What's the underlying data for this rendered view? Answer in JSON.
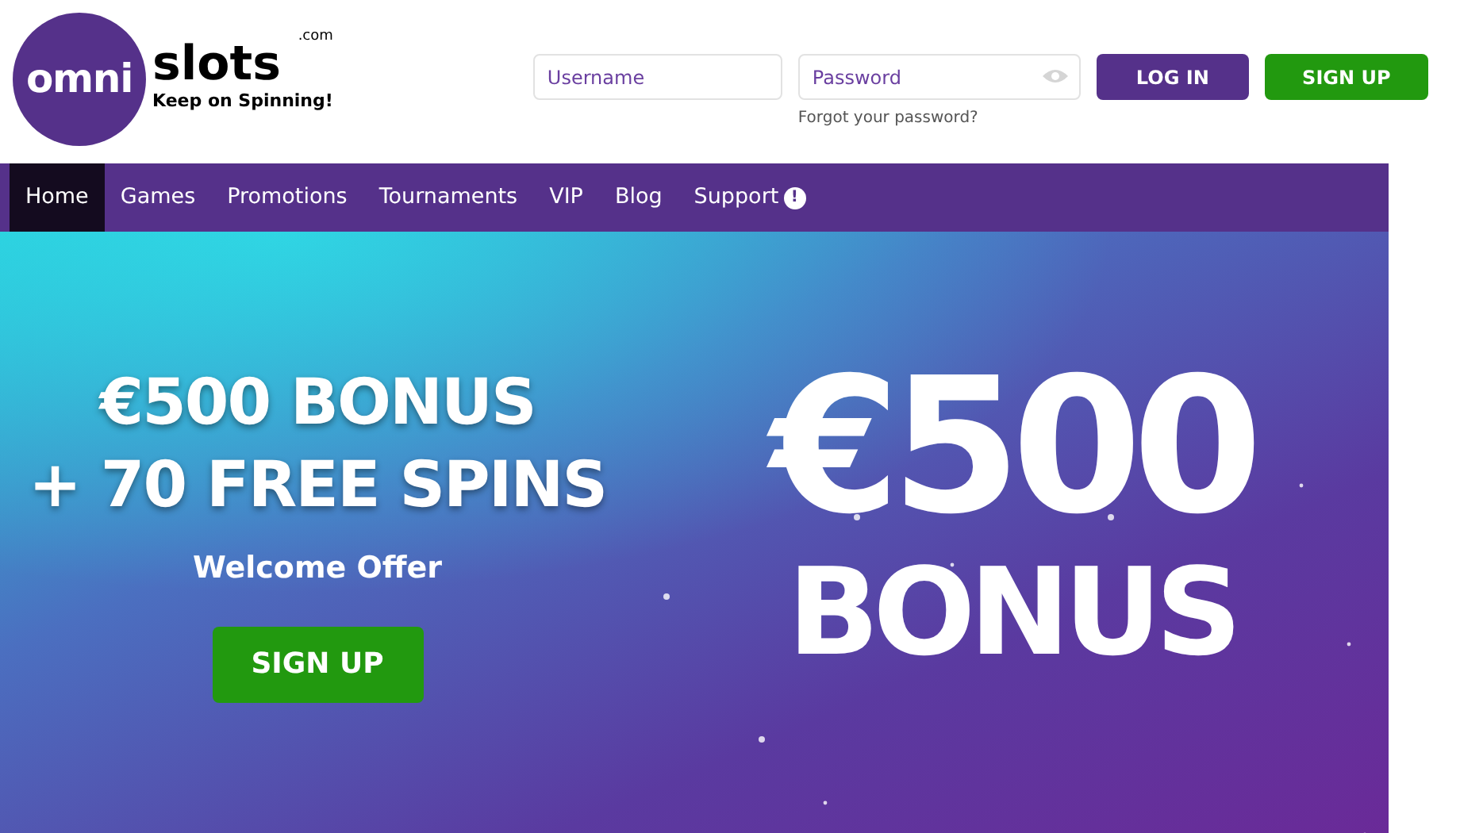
{
  "logo": {
    "circle_text": "omni",
    "wordmark": "slots",
    "domain": ".com",
    "tagline": "Keep on Spinning!"
  },
  "login": {
    "username": {
      "placeholder": "Username"
    },
    "password": {
      "placeholder": "Password"
    },
    "forgot": "Forgot your password?",
    "login_button": "LOG IN",
    "signup_button": "SIGN UP"
  },
  "nav": [
    {
      "label": "Home",
      "selected": true
    },
    {
      "label": "Games",
      "selected": false
    },
    {
      "label": "Promotions",
      "selected": false
    },
    {
      "label": "Tournaments",
      "selected": false
    },
    {
      "label": "VIP",
      "selected": false
    },
    {
      "label": "Blog",
      "selected": false
    },
    {
      "label": "Support",
      "selected": false,
      "badge": "!"
    }
  ],
  "hero": {
    "headline": [
      "€500 BONUS",
      "+ 70 FREE SPINS"
    ],
    "subtitle": "Welcome Offer",
    "button": "SIGN UP",
    "big_amount": "€500",
    "big_word": "BONUS"
  }
}
